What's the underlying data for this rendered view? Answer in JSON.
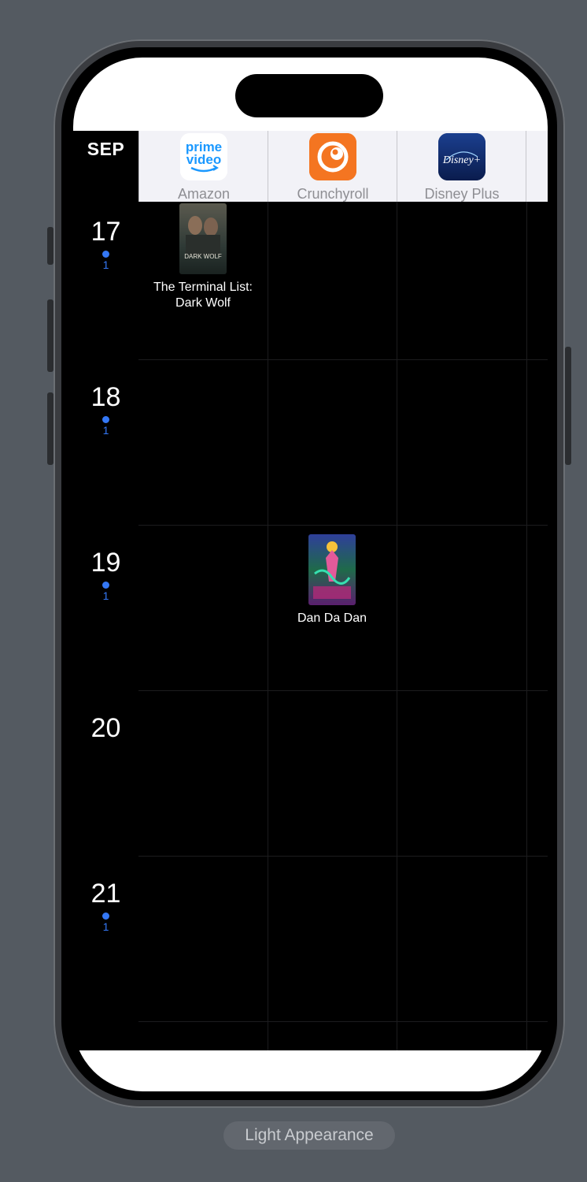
{
  "header": {
    "month": "SEP",
    "services": [
      {
        "name": "Amazon",
        "logo": "prime-video-logo",
        "logo_line1": "prime",
        "logo_line2": "video"
      },
      {
        "name": "Crunchyroll",
        "logo": "crunchyroll-logo"
      },
      {
        "name": "Disney Plus",
        "logo": "disney-plus-logo",
        "logo_text": "Disney+"
      }
    ]
  },
  "days": [
    {
      "day": "17",
      "count": "1"
    },
    {
      "day": "18",
      "count": "1"
    },
    {
      "day": "19",
      "count": "1"
    },
    {
      "day": "20",
      "count": ""
    },
    {
      "day": "21",
      "count": "1"
    }
  ],
  "shows": [
    {
      "title_line1": "The Terminal List:",
      "title_line2": "Dark Wolf",
      "poster_text": "DARK WOLF"
    },
    {
      "title_line1": "Dan Da Dan",
      "title_line2": ""
    }
  ],
  "footer": {
    "appearance_label": "Light Appearance"
  },
  "colors": {
    "accent": "#3478f6",
    "crunchyroll": "#f47521",
    "disney_bg": "#0f2a6b",
    "prime_blue": "#1a98ff"
  }
}
